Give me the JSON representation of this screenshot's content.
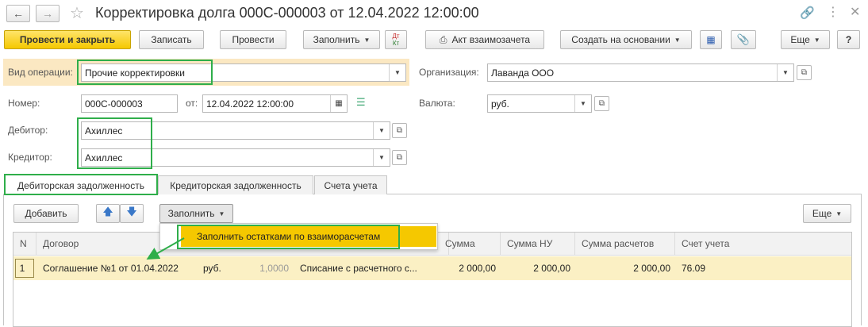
{
  "window": {
    "title": "Корректировка долга 000С-000003 от 12.04.2022 12:00:00"
  },
  "toolbar": {
    "post_close": "Провести и закрыть",
    "write": "Записать",
    "post": "Провести",
    "fill": "Заполнить",
    "dtkt_top": "Дт",
    "dtkt_bottom": "Кт",
    "offset_act": "Акт взаимозачета",
    "create_based": "Создать на основании",
    "more": "Еще",
    "help": "?"
  },
  "form": {
    "op_type_label": "Вид операции:",
    "op_type_value": "Прочие корректировки",
    "org_label": "Организация:",
    "org_value": "Лаванда ООО",
    "number_label": "Номер:",
    "number_value": "000С-000003",
    "date_label": "от:",
    "date_value": "12.04.2022 12:00:00",
    "currency_label": "Валюта:",
    "currency_value": "руб.",
    "debtor_label": "Дебитор:",
    "debtor_value": "Ахиллес",
    "creditor_label": "Кредитор:",
    "creditor_value": "Ахиллес"
  },
  "tabs": [
    {
      "label": "Дебиторская задолженность",
      "active": true
    },
    {
      "label": "Кредиторская задолженность",
      "active": false
    },
    {
      "label": "Счета учета",
      "active": false
    }
  ],
  "table_toolbar": {
    "add": "Добавить",
    "fill": "Заполнить",
    "more": "Еще"
  },
  "fill_menu": {
    "item": "Заполнить остатками по взаиморасчетам"
  },
  "table": {
    "columns": [
      "N",
      "Договор",
      "Сумма",
      "Сумма НУ",
      "Сумма расчетов",
      "Счет учета"
    ],
    "rows": [
      {
        "n": "1",
        "contract": "Соглашение №1 от 01.04.2022",
        "currency": "руб.",
        "rate": "1,0000",
        "description": "Списание с расчетного с...",
        "sum": "2 000,00",
        "sum_nu": "2 000,00",
        "settle_sum": "2 000,00",
        "account": "76.09"
      }
    ]
  },
  "colors": {
    "accent_yellow": "#f5c800",
    "highlight_green": "#2fae4a",
    "selected_row": "#fbf0c4",
    "form_label_bg": "#fbe8c2"
  }
}
